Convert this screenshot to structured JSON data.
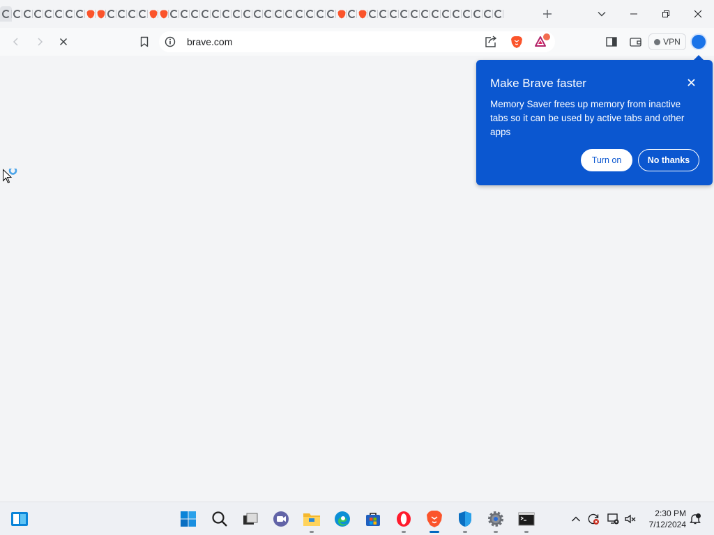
{
  "browser": {
    "url": "brave.com",
    "vpn_label": "VPN",
    "rewards_badge": "1"
  },
  "popup": {
    "title": "Make Brave faster",
    "body": "Memory Saver frees up memory from inactive tabs so it can be used by active tabs and other apps",
    "turn_on_label": "Turn on",
    "no_thanks_label": "No thanks"
  },
  "taskbar": {
    "time": "2:30 PM",
    "date": "7/12/2024"
  },
  "colors": {
    "accent": "#0b57d0",
    "brave": "#fb542b",
    "background": "#f3f4f6"
  },
  "icons": [
    "windows-start-icon",
    "search-icon",
    "task-view-icon",
    "teams-chat-icon",
    "file-explorer-icon",
    "edge-icon",
    "store-icon",
    "opera-icon",
    "brave-icon",
    "defender-icon",
    "settings-icon",
    "terminal-icon"
  ]
}
